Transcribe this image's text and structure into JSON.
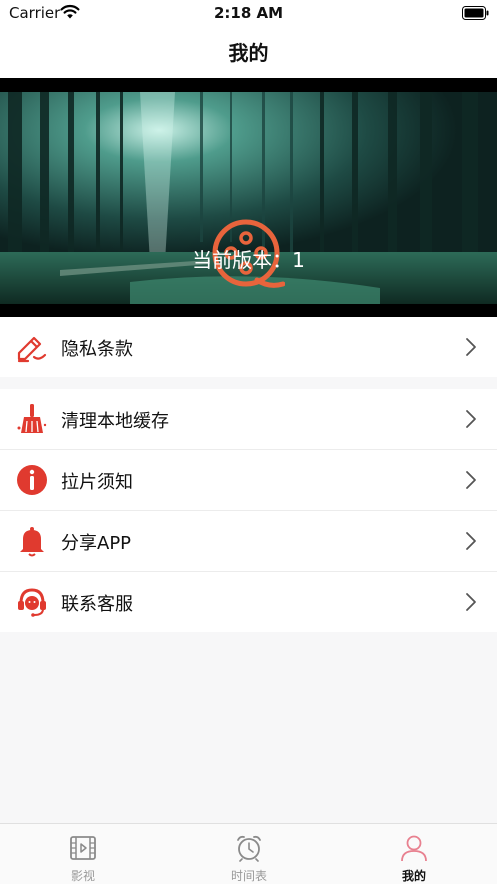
{
  "status_bar": {
    "carrier": "Carrier",
    "time": "2:18 AM"
  },
  "nav": {
    "title": "我的"
  },
  "banner": {
    "version_text": "当前版本：1"
  },
  "menu": {
    "group1": [
      {
        "label": "隐私条款",
        "icon": "pen-edit-icon"
      }
    ],
    "group2": [
      {
        "label": "清理本地缓存",
        "icon": "broom-icon"
      },
      {
        "label": "拉片须知",
        "icon": "info-icon"
      },
      {
        "label": "分享APP",
        "icon": "bell-icon"
      },
      {
        "label": "联系客服",
        "icon": "headset-icon"
      }
    ]
  },
  "tabs": [
    {
      "label": "影视",
      "icon": "film-icon"
    },
    {
      "label": "时间表",
      "icon": "alarm-clock-icon"
    },
    {
      "label": "我的",
      "icon": "user-icon",
      "active": true
    }
  ],
  "colors": {
    "accent": "#e03a2f",
    "banner_logo": "#e8643c",
    "tab_active": "#e8808f"
  }
}
